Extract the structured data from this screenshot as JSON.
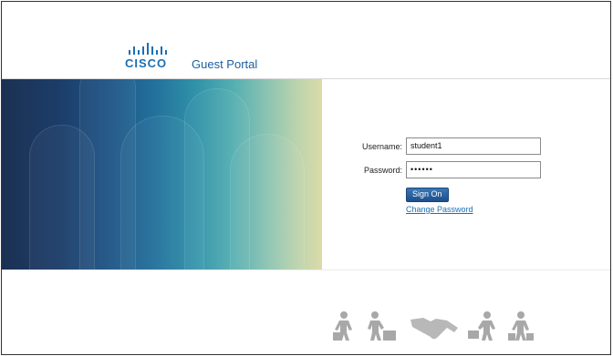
{
  "brand": {
    "logo_text": "CISCO",
    "portal_title": "Guest Portal"
  },
  "login": {
    "username_label": "Username:",
    "username_value": "student1",
    "password_label": "Password:",
    "password_value": "••••••",
    "sign_on_label": "Sign On",
    "change_password_label": "Change Password"
  },
  "footer": {
    "icons": [
      "person-luggage-icon",
      "person-crate-icon",
      "handshake-icon",
      "person-cart-icon",
      "person-bags-icon"
    ]
  },
  "colors": {
    "brand_blue": "#1a6fb5",
    "link_blue": "#1d6fb8",
    "button_blue": "#2a62a2"
  }
}
